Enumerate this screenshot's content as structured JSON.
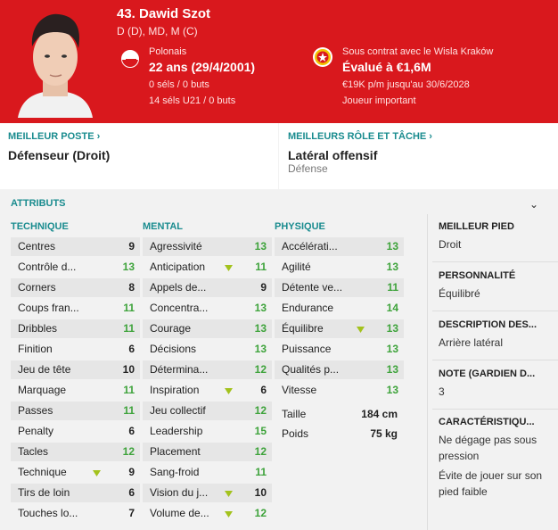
{
  "header": {
    "name": "43. Dawid Szot",
    "positions": "D (D), MD, M (C)",
    "nationality": "Polonais",
    "age": "22 ans (29/4/2001)",
    "caps": "0 séls / 0 buts",
    "caps_u21": "14 séls U21 / 0 buts",
    "contract": "Sous contrat avec le Wisla Kraków",
    "value": "Évalué à €1,6M",
    "wage": "€19K p/m jusqu'au 30/6/2028",
    "status": "Joueur important",
    "colors": {
      "header_bg": "#d9181d",
      "accent": "#1a8c8f",
      "good": "#3ea33b"
    }
  },
  "best_position": {
    "label": "MEILLEUR POSTE",
    "value": "Défenseur (Droit)"
  },
  "best_role": {
    "label": "MEILLEURS RÔLE ET TÂCHE",
    "value": "Latéral offensif",
    "duty": "Défense"
  },
  "attributes": {
    "title": "ATTRIBUTS",
    "technical": {
      "label": "TECHNIQUE",
      "rows": [
        {
          "name": "Centres",
          "value": "9",
          "color": "k",
          "arrow": false
        },
        {
          "name": "Contrôle d...",
          "value": "13",
          "color": "g",
          "arrow": false
        },
        {
          "name": "Corners",
          "value": "8",
          "color": "k",
          "arrow": false
        },
        {
          "name": "Coups fran...",
          "value": "11",
          "color": "g",
          "arrow": false
        },
        {
          "name": "Dribbles",
          "value": "11",
          "color": "g",
          "arrow": false
        },
        {
          "name": "Finition",
          "value": "6",
          "color": "k",
          "arrow": false
        },
        {
          "name": "Jeu de tête",
          "value": "10",
          "color": "k",
          "arrow": false
        },
        {
          "name": "Marquage",
          "value": "11",
          "color": "g",
          "arrow": false
        },
        {
          "name": "Passes",
          "value": "11",
          "color": "g",
          "arrow": false
        },
        {
          "name": "Penalty",
          "value": "6",
          "color": "k",
          "arrow": false
        },
        {
          "name": "Tacles",
          "value": "12",
          "color": "g",
          "arrow": false
        },
        {
          "name": "Technique",
          "value": "9",
          "color": "k",
          "arrow": true
        },
        {
          "name": "Tirs de loin",
          "value": "6",
          "color": "k",
          "arrow": false
        },
        {
          "name": "Touches lo...",
          "value": "7",
          "color": "k",
          "arrow": false
        }
      ]
    },
    "mental": {
      "label": "MENTAL",
      "rows": [
        {
          "name": "Agressivité",
          "value": "13",
          "color": "g",
          "arrow": false
        },
        {
          "name": "Anticipation",
          "value": "11",
          "color": "g",
          "arrow": true
        },
        {
          "name": "Appels de...",
          "value": "9",
          "color": "k",
          "arrow": false
        },
        {
          "name": "Concentra...",
          "value": "13",
          "color": "g",
          "arrow": false
        },
        {
          "name": "Courage",
          "value": "13",
          "color": "g",
          "arrow": false
        },
        {
          "name": "Décisions",
          "value": "13",
          "color": "g",
          "arrow": false
        },
        {
          "name": "Détermina...",
          "value": "12",
          "color": "g",
          "arrow": false
        },
        {
          "name": "Inspiration",
          "value": "6",
          "color": "k",
          "arrow": true
        },
        {
          "name": "Jeu collectif",
          "value": "12",
          "color": "g",
          "arrow": false
        },
        {
          "name": "Leadership",
          "value": "15",
          "color": "g",
          "arrow": false
        },
        {
          "name": "Placement",
          "value": "12",
          "color": "g",
          "arrow": false
        },
        {
          "name": "Sang-froid",
          "value": "11",
          "color": "g",
          "arrow": false
        },
        {
          "name": "Vision du j...",
          "value": "10",
          "color": "k",
          "arrow": true
        },
        {
          "name": "Volume de...",
          "value": "12",
          "color": "g",
          "arrow": true
        }
      ]
    },
    "physical": {
      "label": "PHYSIQUE",
      "rows": [
        {
          "name": "Accélérati...",
          "value": "13",
          "color": "g",
          "arrow": false
        },
        {
          "name": "Agilité",
          "value": "13",
          "color": "g",
          "arrow": false
        },
        {
          "name": "Détente ve...",
          "value": "11",
          "color": "g",
          "arrow": false
        },
        {
          "name": "Endurance",
          "value": "14",
          "color": "g",
          "arrow": false
        },
        {
          "name": "Équilibre",
          "value": "13",
          "color": "g",
          "arrow": true
        },
        {
          "name": "Puissance",
          "value": "13",
          "color": "g",
          "arrow": false
        },
        {
          "name": "Qualités p...",
          "value": "13",
          "color": "g",
          "arrow": false
        },
        {
          "name": "Vitesse",
          "value": "13",
          "color": "g",
          "arrow": false
        }
      ],
      "height_label": "Taille",
      "height_value": "184 cm",
      "weight_label": "Poids",
      "weight_value": "75 kg"
    }
  },
  "side": {
    "foot_h": "MEILLEUR PIED",
    "foot": "Droit",
    "pers_h": "PERSONNALITÉ",
    "pers": "Équilibré",
    "desc_h": "DESCRIPTION DES...",
    "desc": "Arrière latéral",
    "note_h": "NOTE (GARDIEN D...",
    "note": "3",
    "traits_h": "CARACTÉRISTIQU...",
    "traits": [
      "Ne dégage pas sous pression",
      "Évite de jouer sur son pied faible"
    ]
  }
}
